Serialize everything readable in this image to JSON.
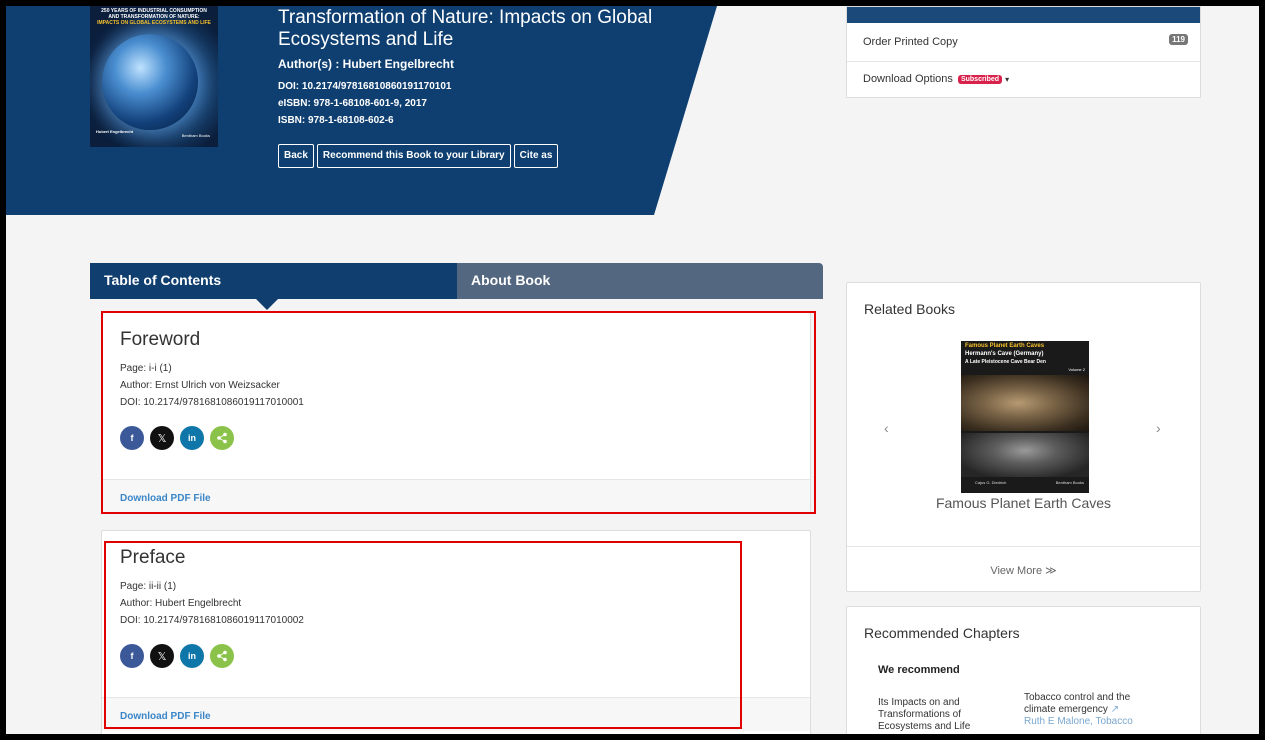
{
  "book": {
    "cover": {
      "title_line1": "250 YEARS OF INDUSTRIAL CONSUMPTION",
      "title_line2": "AND TRANSFORMATION OF NATURE:",
      "title_line3": "IMPACTS ON GLOBAL ECOSYSTEMS AND LIFE",
      "author": "Hubert Engelbrecht",
      "publisher": "Bentham Books"
    },
    "title": "Transformation of Nature: Impacts on Global Ecosystems and Life",
    "authors": "Author(s) : Hubert Engelbrecht",
    "doi": "DOI: 10.2174/97816810860191170101",
    "eisbn": "eISBN: 978-1-68108-601-9, 2017",
    "isbn": "ISBN: 978-1-68108-602-6",
    "buttons": {
      "back": "Back",
      "recommend": "Recommend this Book to your Library",
      "cite": "Cite as"
    }
  },
  "order": {
    "printed_label": "Order Printed Copy",
    "printed_count": "119",
    "download_label": "Download Options",
    "subscribed_badge": "Subscribed"
  },
  "tabs": {
    "toc": "Table of Contents",
    "about": "About Book"
  },
  "chapters": [
    {
      "title": "Foreword",
      "page": "Page: i-i (1)",
      "author": "Author: Ernst Ulrich von Weizsacker",
      "doi": "DOI: 10.2174/9781681086019117010001",
      "download": "Download PDF File"
    },
    {
      "title": "Preface",
      "page": "Page: ii-ii (1)",
      "author": "Author: Hubert Engelbrecht",
      "doi": "DOI: 10.2174/9781681086019117010002",
      "download": "Download PDF File"
    }
  ],
  "share": {
    "facebook": "f",
    "x": "𝕏",
    "linkedin": "in",
    "share": "<"
  },
  "related": {
    "heading": "Related Books",
    "cover_series": "Famous Planet Earth Caves",
    "cover_title": "Hermann's Cave (Germany)",
    "cover_subtitle": "A Late Pleistocene Cave Bear Den",
    "cover_volume": "Volume 2",
    "cover_author": "Cajus G. Diedrich",
    "cover_publisher": "Bentham Books",
    "book_name": "Famous Planet Earth Caves",
    "prev": "‹",
    "next": "›",
    "view_more": "View More ≫"
  },
  "recommended": {
    "heading": "Recommended Chapters",
    "we_recommend": "We recommend",
    "item1_line1": "Its Impacts on and",
    "item1_line2": "Transformations of",
    "item1_line3": "Ecosystems and Life",
    "item2_line1": "Tobacco control and the",
    "item2_line2": "climate emergency",
    "item2_link_icon": "↗",
    "item2_line3": "Ruth E Malone, Tobacco"
  },
  "colors": {
    "hero_blue": "#0e3f70",
    "tab_active": "#0f3e6f",
    "tab_inactive": "#536780",
    "link_blue": "#3a86c8",
    "badge_red": "#d9224b",
    "highlight_red": "#e10000"
  }
}
